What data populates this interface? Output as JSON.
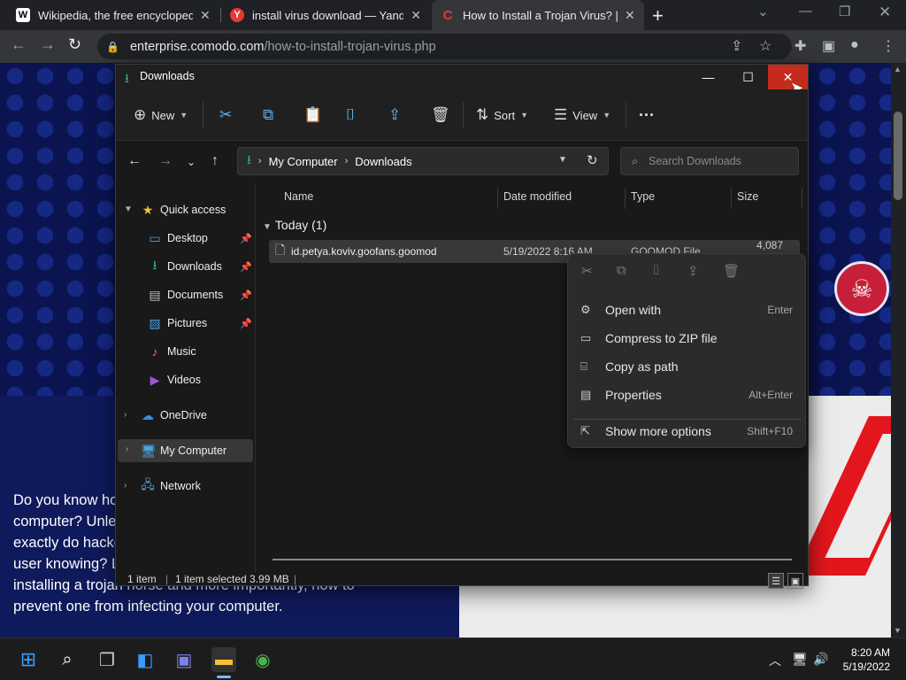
{
  "browser": {
    "tabs": [
      {
        "favicon": "W",
        "title": "Wikipedia, the free encyclopedia"
      },
      {
        "favicon": "Y",
        "title": "install virus download — Yandex"
      },
      {
        "favicon": "C",
        "title": "How to Install a Trojan Virus? | W"
      }
    ],
    "address": {
      "host": "enterprise.comodo.com",
      "path": "/how-to-install-trojan-virus.php"
    }
  },
  "page": {
    "paragraph": "Do you know how to install a trojan virus on a computer? Unless you're a hacker, probably not! How exactly do hackers install trojans on devices without the user knowing? Let's discuss the different methods of installing a trojan horse and more importantly, how to prevent one from infecting your computer."
  },
  "explorer": {
    "title": "Downloads",
    "toolbar": {
      "new": "New",
      "sort": "Sort",
      "view": "View"
    },
    "breadcrumb": [
      "My Computer",
      "Downloads"
    ],
    "search_placeholder": "Search Downloads",
    "nav": {
      "quick_access": "Quick access",
      "desktop": "Desktop",
      "downloads": "Downloads",
      "documents": "Documents",
      "pictures": "Pictures",
      "music": "Music",
      "videos": "Videos",
      "onedrive": "OneDrive",
      "my_computer": "My Computer",
      "network": "Network"
    },
    "columns": {
      "name": "Name",
      "date": "Date modified",
      "type": "Type",
      "size": "Size"
    },
    "group": "Today (1)",
    "file": {
      "name": "id.petya.koviv.goofans.goomod",
      "date": "5/19/2022 8:16 AM",
      "type": "GOOMOD File",
      "size": "4,087 KB"
    },
    "status": {
      "items": "1 item",
      "selected": "1 item selected  3.99 MB"
    }
  },
  "context_menu": {
    "items": [
      {
        "label": "Open with",
        "shortcut": "Enter",
        "icon": "open-with-icon"
      },
      {
        "label": "Compress to ZIP file",
        "shortcut": "",
        "icon": "zip-icon"
      },
      {
        "label": "Copy as path",
        "shortcut": "",
        "icon": "copy-path-icon"
      },
      {
        "label": "Properties",
        "shortcut": "Alt+Enter",
        "icon": "properties-icon"
      },
      {
        "label": "Show more options",
        "shortcut": "Shift+F10",
        "icon": "more-options-icon"
      }
    ]
  },
  "taskbar": {
    "time": "8:20 AM",
    "date": "5/19/2022"
  }
}
